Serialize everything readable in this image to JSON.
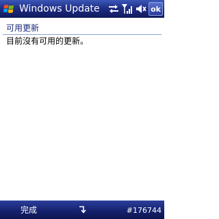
{
  "titlebar": {
    "title": "Windows Update",
    "ok_label": "ok",
    "icons": [
      "windows-start-icon",
      "sync-arrows-icon",
      "signal-strength-icon",
      "speaker-icon"
    ]
  },
  "section": {
    "header": "可用更新",
    "message": "目前沒有可用的更新。"
  },
  "softbar": {
    "left_label": "完成",
    "right_label": "#176744",
    "center_icon": "keyboard-icon"
  },
  "colors": {
    "titlebar": "#1f2f86",
    "section_header_text": "#1a2a78",
    "divider": "#8ea0d0"
  }
}
